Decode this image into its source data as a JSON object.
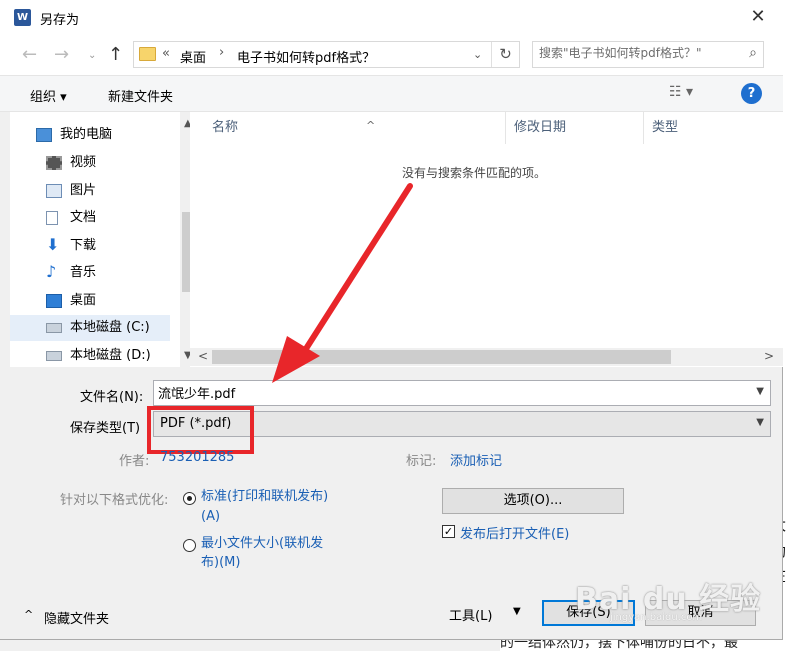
{
  "window": {
    "title": "另存为",
    "app_icon": "W",
    "close": "✕"
  },
  "nav": {
    "back_icon": "←",
    "forward_icon": "→",
    "recent_icon": "⌄",
    "up_icon": "↑",
    "path_prefix": "«",
    "crumbs": [
      "桌面",
      "电子书如何转pdf格式？"
    ],
    "crumb_sep": "›",
    "path_dropdown": "⌄",
    "refresh_icon": "↻",
    "search_placeholder": "搜索\"电子书如何转pdf格式？\"",
    "search_icon": "⌕"
  },
  "toolbar": {
    "organize": "组织 ▾",
    "new_folder": "新建文件夹",
    "view_icon": "☷ ▾",
    "help": "?"
  },
  "sidebar": {
    "items": [
      {
        "label": "我的电脑",
        "icon": "computer-icon"
      },
      {
        "label": "视频",
        "icon": "video-icon"
      },
      {
        "label": "图片",
        "icon": "pictures-icon"
      },
      {
        "label": "文档",
        "icon": "documents-icon"
      },
      {
        "label": "下载",
        "icon": "downloads-icon"
      },
      {
        "label": "音乐",
        "icon": "music-icon"
      },
      {
        "label": "桌面",
        "icon": "desktop-icon"
      },
      {
        "label": "本地磁盘 (C:)",
        "icon": "drive-icon"
      },
      {
        "label": "本地磁盘 (D:)",
        "icon": "drive-icon"
      }
    ],
    "scroll_up": "▲",
    "scroll_down": "▼"
  },
  "files": {
    "columns": [
      "名称",
      "修改日期",
      "类型"
    ],
    "sort_indicator": "^",
    "empty_message": "没有与搜索条件匹配的项。",
    "scroll_left": "<",
    "scroll_right": ">"
  },
  "form": {
    "filename_label": "文件名(N):",
    "filename_value": "流氓少年.pdf",
    "filetype_label": "保存类型(T)",
    "filetype_value": "PDF (*.pdf)",
    "author_label": "作者:",
    "author_value": "753201285",
    "tags_label": "标记:",
    "tags_value": "添加标记",
    "optimize_label": "针对以下格式优化:",
    "option1_line1": "标准(打印和联机发布)",
    "option1_line2": "(A)",
    "option2_line1": "最小文件大小(联机发",
    "option2_line2": "布)(M)",
    "options_button": "选项(O)...",
    "open_after_label": "发布后打开文件(E)",
    "open_after_checked": "✓"
  },
  "footer": {
    "hide_folders": "隐藏文件夹",
    "hide_icon": "^",
    "tools": "工具(L)",
    "tools_dd": "▼",
    "save": "保存(S)",
    "cancel": "取消"
  },
  "background": {
    "right_frags": [
      "太",
      "劫",
      "在"
    ],
    "bottom_text": "的一结体然仍，摆下体哺份的日不，最"
  },
  "watermark": {
    "brand": "Bai du 经验",
    "sub": "jingyan.baidu.com"
  },
  "colors": {
    "highlight_red": "#e8262a",
    "link_blue": "#1a5fb4",
    "help_blue": "#1f6fcf"
  }
}
